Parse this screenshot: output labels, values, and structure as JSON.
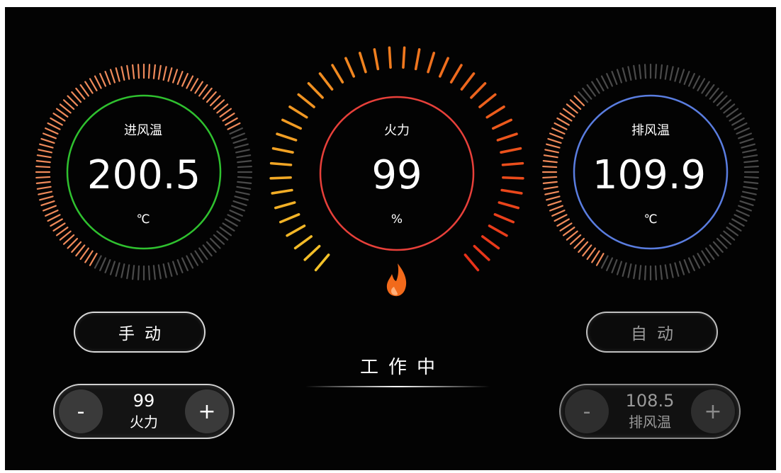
{
  "colors": {
    "inlet_ring": "#2fc12f",
    "power_ring": "#e8403a",
    "exhaust_ring": "#5a7de0",
    "tick_orange": "#ef8a5a",
    "tick_gray": "#4a4a4a",
    "flame": "#f26a1b"
  },
  "gauges": {
    "inlet": {
      "title": "进风温",
      "value": "200.5",
      "unit": "℃",
      "fill_fraction": 0.6
    },
    "power": {
      "title": "火力",
      "value": "99",
      "unit": "%",
      "fill_fraction": 0.99,
      "icon": "flame-icon"
    },
    "exhaust": {
      "title": "排风温",
      "value": "109.9",
      "unit": "℃",
      "fill_fraction": 0.3
    }
  },
  "mode": {
    "manual_label": "手动",
    "auto_label": "自动"
  },
  "status": {
    "text": "工作中"
  },
  "steppers": {
    "power": {
      "minus": "-",
      "plus": "+",
      "value": "99",
      "label": "火力"
    },
    "exhaust": {
      "minus": "-",
      "plus": "+",
      "value": "108.5",
      "label": "排风温"
    }
  }
}
